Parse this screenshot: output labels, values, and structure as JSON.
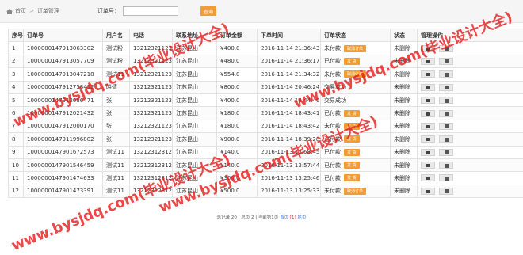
{
  "breadcrumb": {
    "home": "首页",
    "separator": ">",
    "current": "订单管理"
  },
  "search": {
    "label": "订单号：",
    "value": "",
    "placeholder": "",
    "button": "查询"
  },
  "table": {
    "headers": [
      "序号",
      "订单号",
      "用户名",
      "电话",
      "联系地址",
      "订单金额",
      "下单时间",
      "订单状态",
      "状态",
      "管理操作"
    ],
    "rows": [
      {
        "no": "1",
        "order": "1000000147913063302",
        "user": "测试粉",
        "phone": "13212321123",
        "addr": "江苏昆山",
        "amount": "¥400.0",
        "time": "2016-11-14 21:36:43",
        "status": "未付款",
        "badge": "取消订单",
        "state": "未删除"
      },
      {
        "no": "2",
        "order": "1000000147913057709",
        "user": "测试粉",
        "phone": "13212321123",
        "addr": "江苏昆山",
        "amount": "¥480.0",
        "time": "2016-11-14 21:36:17",
        "status": "已付款",
        "badge": "发 货",
        "state": "未删除"
      },
      {
        "no": "3",
        "order": "1000000147913047218",
        "user": "测试11",
        "phone": "13212321123",
        "addr": "江苏昆山",
        "amount": "¥554.0",
        "time": "2016-11-14 21:34:32",
        "status": "未付款",
        "badge": "取消订单",
        "state": "未删除"
      },
      {
        "no": "4",
        "order": "1000000147912758412",
        "user": "晓倩",
        "phone": "13212321123",
        "addr": "江苏昆山",
        "amount": "¥800.0",
        "time": "2016-11-14 20:46:24",
        "status": "交易成功",
        "badge": "",
        "state": "未删除"
      },
      {
        "no": "5",
        "order": "1000000147912086471",
        "user": "张",
        "phone": "13212321123",
        "addr": "江苏昆山",
        "amount": "¥400.0",
        "time": "2016-11-14 18:44:46",
        "status": "交易成功",
        "badge": "",
        "state": "未删除"
      },
      {
        "no": "6",
        "order": "1000000147912021432",
        "user": "张",
        "phone": "13212321123",
        "addr": "江苏昆山",
        "amount": "¥180.0",
        "time": "2016-11-14 18:43:41",
        "status": "已付款",
        "badge": "发 货",
        "state": "未删除"
      },
      {
        "no": "7",
        "order": "1000000147912000170",
        "user": "张",
        "phone": "13212321123",
        "addr": "江苏昆山",
        "amount": "¥180.0",
        "time": "2016-11-14 18:43:42",
        "status": "未付款",
        "badge": "发 货",
        "state": "未删除"
      },
      {
        "no": "8",
        "order": "1000000147911996802",
        "user": "张",
        "phone": "13212321123",
        "addr": "江苏昆山",
        "amount": "¥900.0",
        "time": "2016-11-14 18:39:28",
        "status": "已付款",
        "badge": "发 货",
        "state": "未删除"
      },
      {
        "no": "9",
        "order": "1000000147901672573",
        "user": "测试11",
        "phone": "13212312312",
        "addr": "江苏昆山",
        "amount": "¥140.0",
        "time": "2016-11-13 13:58:45",
        "status": "已付款",
        "badge": "发 货",
        "state": "未删除"
      },
      {
        "no": "10",
        "order": "1000000147901546459",
        "user": "测试11",
        "phone": "13212312312",
        "addr": "江苏昆山",
        "amount": "¥140.0",
        "time": "2016-11-13 13:57:44",
        "status": "已付款",
        "badge": "发 货",
        "state": "未删除"
      },
      {
        "no": "11",
        "order": "1000000147901474633",
        "user": "测试11",
        "phone": "13212312312",
        "addr": "江苏昆山",
        "amount": "¥300.0",
        "time": "2016-11-13 13:25:46",
        "status": "已付款",
        "badge": "发 货",
        "state": "未删除"
      },
      {
        "no": "12",
        "order": "1000000147901473391",
        "user": "测试11",
        "phone": "13212312312",
        "addr": "江苏昆山",
        "amount": "¥500.0",
        "time": "2016-11-13 13:25:33",
        "status": "未付款",
        "badge": "取消订单",
        "state": "未删除"
      }
    ]
  },
  "footer": {
    "text": "总记录 20 | 总页 2 | 当前第1页",
    "first": "首页",
    "page": "[1]",
    "last": "尾页"
  },
  "watermark": "www.bysjdq.com(毕业设计大全)",
  "colors": {
    "accent": "#f39c34",
    "watermark": "#e61414",
    "link": "#3a6fd8"
  }
}
